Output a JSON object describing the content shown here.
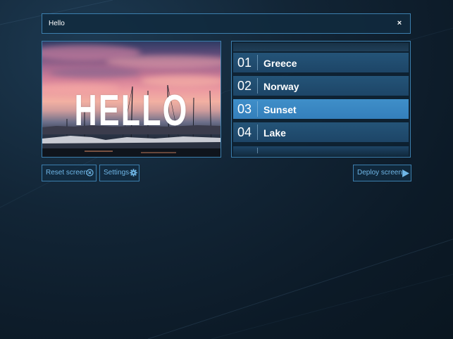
{
  "search": {
    "value": "Hello",
    "clear_icon": "close-icon",
    "clear_glyph": "×"
  },
  "preview": {
    "overlay_text": "HELLO",
    "image": "sunset-marina-photo"
  },
  "list": {
    "items": [
      {
        "number": "01",
        "label": "Greece",
        "selected": false
      },
      {
        "number": "02",
        "label": "Norway",
        "selected": false
      },
      {
        "number": "03",
        "label": "Sunset",
        "selected": true
      },
      {
        "number": "04",
        "label": "Lake",
        "selected": false
      }
    ]
  },
  "buttons": {
    "reset_label": "Reset screen",
    "reset_icon": "circle-x-icon",
    "settings_label": "Settings",
    "settings_icon": "gear-icon",
    "deploy_label": "Deploy screen",
    "deploy_icon": "play-icon"
  },
  "colors": {
    "accent": "#3c7fae",
    "selected_item": "#3a88c2",
    "button_text": "#6fb6e6",
    "background": "#0f1f2d"
  }
}
